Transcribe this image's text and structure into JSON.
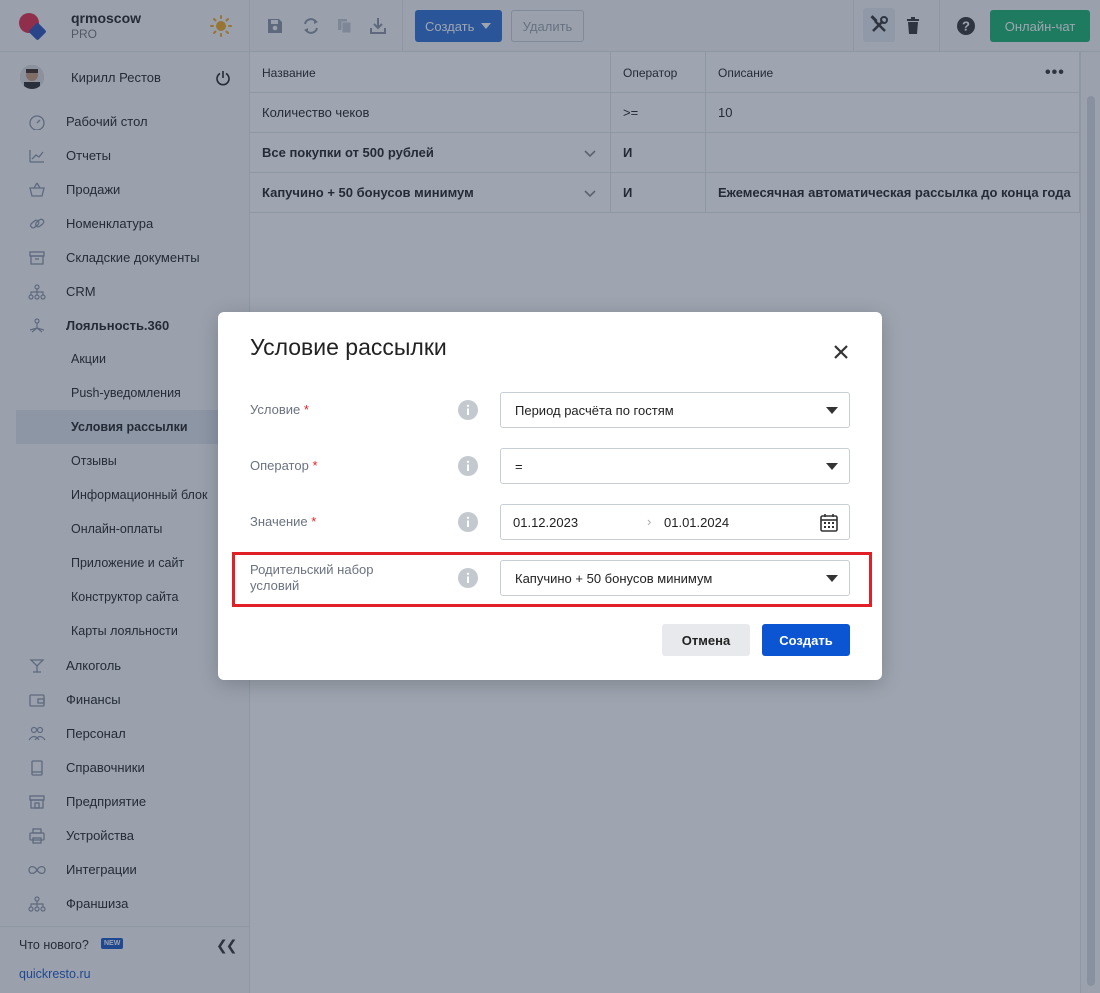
{
  "brand": {
    "name": "qrmoscow",
    "plan": "PRO"
  },
  "user": {
    "name": "Кирилл Рестов"
  },
  "nav": {
    "items": [
      {
        "label": "Рабочий стол",
        "icon": "dashboard-icon"
      },
      {
        "label": "Отчеты",
        "icon": "chart-icon"
      },
      {
        "label": "Продажи",
        "icon": "basket-icon"
      },
      {
        "label": "Номенклатура",
        "icon": "link-icon"
      },
      {
        "label": "Складские документы",
        "icon": "archive-icon"
      },
      {
        "label": "CRM",
        "icon": "hierarchy-icon"
      },
      {
        "label": "Лояльность.360",
        "icon": "loyalty-icon"
      }
    ],
    "sub_items": [
      {
        "label": "Акции"
      },
      {
        "label": "Push-уведомления"
      },
      {
        "label": "Условия рассылки"
      },
      {
        "label": "Отзывы"
      },
      {
        "label": "Информационный блок"
      },
      {
        "label": "Онлайн-оплаты"
      },
      {
        "label": "Приложение и сайт"
      },
      {
        "label": "Конструктор сайта"
      },
      {
        "label": "Карты лояльности"
      }
    ],
    "items_after": [
      {
        "label": "Алкоголь",
        "icon": "glass-icon"
      },
      {
        "label": "Финансы",
        "icon": "wallet-icon"
      },
      {
        "label": "Персонал",
        "icon": "people-icon"
      },
      {
        "label": "Справочники",
        "icon": "book-icon"
      },
      {
        "label": "Предприятие",
        "icon": "store-icon"
      },
      {
        "label": "Устройства",
        "icon": "printer-icon"
      },
      {
        "label": "Интеграции",
        "icon": "infinity-icon"
      },
      {
        "label": "Франшиза",
        "icon": "hierarchy-icon"
      }
    ],
    "active": "Условия рассылки"
  },
  "footer": {
    "whats_new": "Что нового?",
    "new_badge": "NEW",
    "site": "quickresto.ru"
  },
  "toolbar": {
    "create_label": "Создать",
    "delete_label": "Удалить",
    "chat_label": "Онлайн-чат"
  },
  "table": {
    "headers": {
      "name": "Название",
      "operator": "Оператор",
      "description": "Описание"
    },
    "rows": [
      {
        "name": "Количество чеков",
        "operator": ">=",
        "description": "10",
        "bold": false
      },
      {
        "name": "Все покупки от 500 рублей",
        "operator": "И",
        "description": "",
        "bold": true
      },
      {
        "name": "Капучино + 50 бонусов минимум",
        "operator": "И",
        "description": "Ежемесячная автоматическая рассылка до конца года",
        "bold": true
      }
    ]
  },
  "modal": {
    "title": "Условие рассылки",
    "fields": {
      "condition": {
        "label": "Условие",
        "required": "*",
        "value": "Период расчёта по гостям"
      },
      "operator": {
        "label": "Оператор",
        "required": "*",
        "value": "="
      },
      "value": {
        "label": "Значение",
        "required": "*",
        "date_from": "01.12.2023",
        "date_to": "01.01.2024"
      },
      "parent": {
        "label_line1": "Родительский набор",
        "label_line2": "условий",
        "value": "Капучино + 50 бонусов минимум"
      }
    },
    "cancel_label": "Отмена",
    "submit_label": "Создать"
  },
  "colors": {
    "accent": "#0c55d2",
    "chat": "#16b36e",
    "highlight": "#e01f26",
    "required": "#e02424"
  }
}
